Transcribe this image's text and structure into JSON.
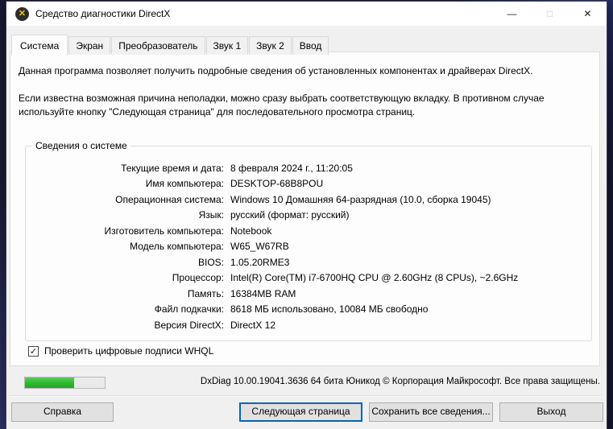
{
  "window": {
    "title": "Средство диагностики DirectX"
  },
  "icons": {
    "directx": "✕",
    "minimize": "—",
    "maximize": "□",
    "close": "✕",
    "check": "✓"
  },
  "tabs": [
    {
      "label": "Система",
      "active": true
    },
    {
      "label": "Экран",
      "active": false
    },
    {
      "label": "Преобразователь",
      "active": false
    },
    {
      "label": "Звук 1",
      "active": false
    },
    {
      "label": "Звук 2",
      "active": false
    },
    {
      "label": "Ввод",
      "active": false
    }
  ],
  "intro": {
    "line1": "Данная программа позволяет получить подробные сведения об установленных компонентах и драйверах DirectX.",
    "line2": "Если известна возможная причина неполадки, можно сразу выбрать соответствующую вкладку. В противном случае используйте кнопку \"Следующая страница\" для последовательного просмотра страниц."
  },
  "system_info": {
    "group_title": "Сведения о системе",
    "rows": [
      {
        "label": "Текущие время и дата:",
        "value": "8 февраля 2024 г., 11:20:05"
      },
      {
        "label": "Имя компьютера:",
        "value": "DESKTOP-68B8POU"
      },
      {
        "label": "Операционная система:",
        "value": "Windows 10 Домашняя 64-разрядная (10.0, сборка 19045)"
      },
      {
        "label": "Язык:",
        "value": "русский (формат: русский)"
      },
      {
        "label": "Изготовитель компьютера:",
        "value": "Notebook"
      },
      {
        "label": "Модель компьютера:",
        "value": "W65_W67RB"
      },
      {
        "label": "BIOS:",
        "value": "1.05.20RME3"
      },
      {
        "label": "Процессор:",
        "value": "Intel(R) Core(TM) i7-6700HQ CPU @ 2.60GHz (8 CPUs), ~2.6GHz"
      },
      {
        "label": "Память:",
        "value": "16384MB RAM"
      },
      {
        "label": "Файл подкачки:",
        "value": "8618 МБ использовано, 10084 МБ свободно"
      },
      {
        "label": "Версия DirectX:",
        "value": "DirectX 12"
      }
    ]
  },
  "whql_checkbox": {
    "label": "Проверить цифровые подписи WHQL",
    "checked": true
  },
  "status_bar": {
    "progress_percent": 62,
    "version_text": "DxDiag 10.00.19041.3636 64 бита Юникод © Корпорация Майкрософт. Все права защищены."
  },
  "buttons": {
    "help": "Справка",
    "next_page": "Следующая страница",
    "save_all": "Сохранить все сведения...",
    "exit": "Выход"
  },
  "colors": {
    "titlebar_bg": "#ffffff",
    "dialog_bg": "#f0f0f0",
    "page_bg": "#fdfdfd",
    "progress_green": "#2db82d",
    "focus_blue": "#0066b4",
    "dx_icon_yellow": "#f2c500"
  }
}
